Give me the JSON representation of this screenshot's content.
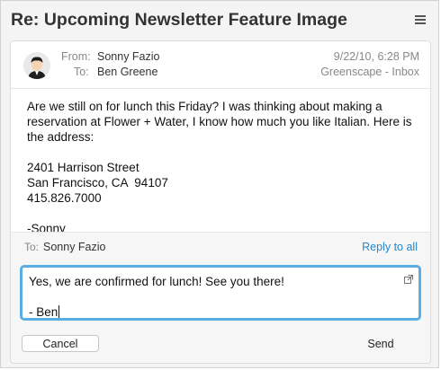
{
  "message": {
    "subject": "Re: Upcoming Newsletter Feature Image",
    "from_label": "From:",
    "from_name": "Sonny Fazio",
    "to_label": "To:",
    "to_name": "Ben Greene",
    "date": "9/22/10, 6:28 PM",
    "mailbox": "Greenscape - Inbox",
    "body": {
      "paragraph": "Are we still on for lunch this Friday? I was thinking about making a reservation at Flower + Water, I know how much you like Italian. Here is the address:",
      "address_line1": "2401 Harrison Street",
      "address_line2": "San Francisco, CA  94107",
      "phone": "415.826.7000",
      "signature": "-Sonny"
    }
  },
  "reply": {
    "to_label": "To:",
    "to_name": "Sonny Fazio",
    "reply_all_label": "Reply to all",
    "line1": "Yes, we are confirmed for lunch! See you there!",
    "line2": "- Ben",
    "cancel_label": "Cancel",
    "send_label": "Send"
  },
  "colors": {
    "accent": "#5aaee3",
    "link": "#2a86c9"
  }
}
